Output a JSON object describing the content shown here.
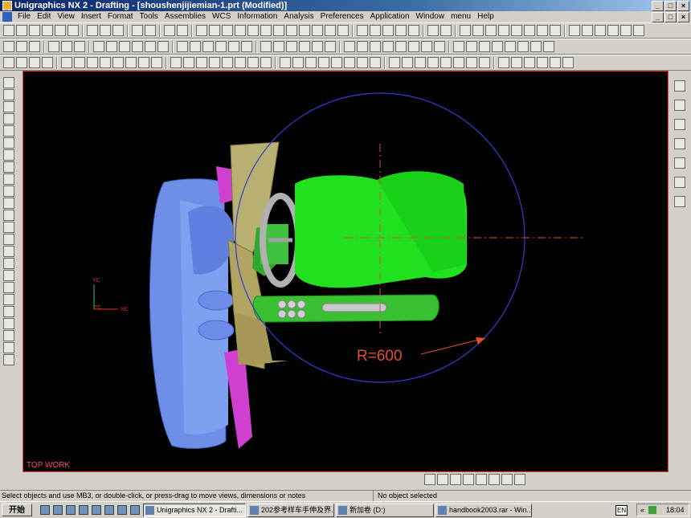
{
  "window": {
    "title": "Unigraphics NX 2 - Drafting - [shoushenjijiemian-1.prt (Modified)]"
  },
  "menu": [
    "File",
    "Edit",
    "View",
    "Insert",
    "Format",
    "Tools",
    "Assemblies",
    "WCS",
    "Information",
    "Analysis",
    "Preferences",
    "Application",
    "Window",
    "menu",
    "Help"
  ],
  "viewport": {
    "view_label": "TOP WORK",
    "radius_label": "R=600",
    "axis_y": "YC",
    "axis_x": "XC",
    "axis_z": "ZC"
  },
  "status": {
    "prompt": "Select objects and use MB3, or double-click, or press-drag to move views, dimensions or notes",
    "selection": "No object selected"
  },
  "taskbar": {
    "start": "开始",
    "tasks": [
      "Unigraphics NX 2 - Drafti...",
      "202参考样车手伸及界...",
      "新加卷 (D:)",
      "handbook2003.rar - Win..."
    ],
    "lang": "EN",
    "clock": "18:04"
  },
  "colors": {
    "title_start": "#0a246a",
    "viewport_bg": "#000000",
    "dim_color": "#e05030",
    "circle_color": "#3040d0",
    "seat_green": "#20e020"
  }
}
